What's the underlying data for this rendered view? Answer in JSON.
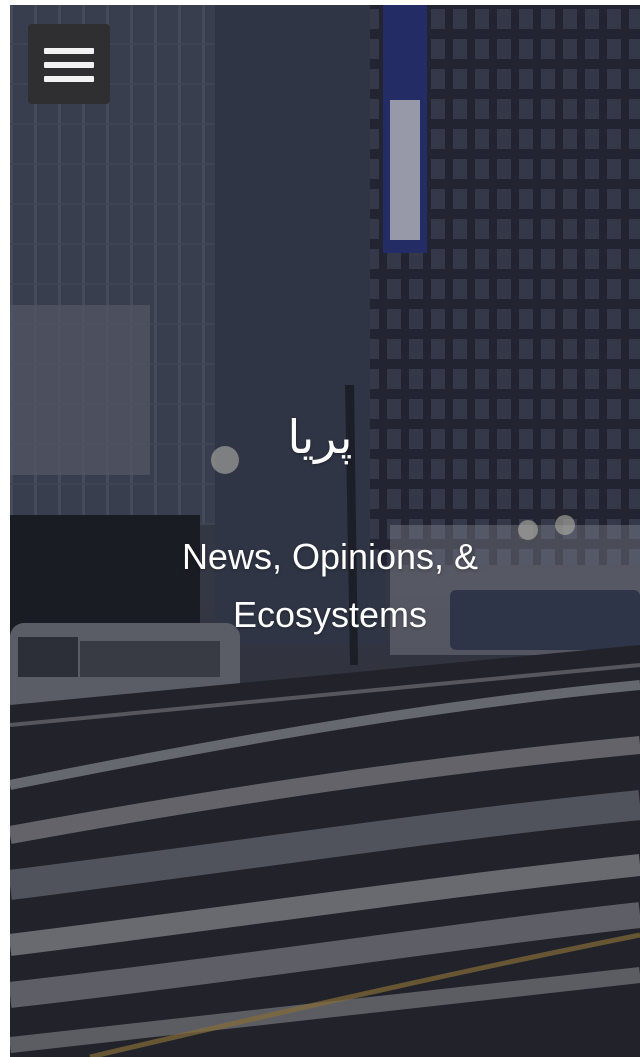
{
  "header": {
    "menu_icon": "hamburger-menu-icon"
  },
  "hero": {
    "background_description_icon": "city-night-street-photo",
    "brand_title": "پریا",
    "tagline": "News, Opinions, & Ecosystems"
  },
  "colors": {
    "menu_button_bg": "#2f2f31",
    "menu_bar": "#f2f2f2",
    "text": "#ffffff"
  }
}
